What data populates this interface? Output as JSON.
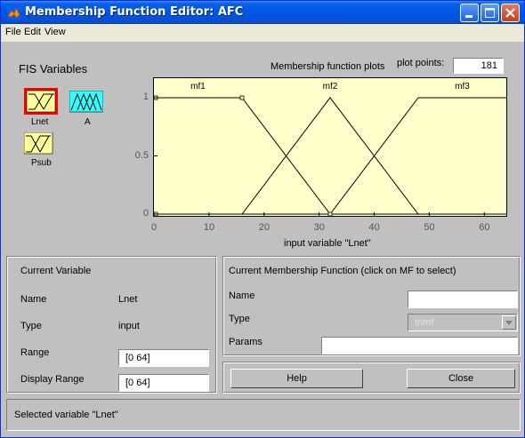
{
  "window": {
    "title": "Membership Function Editor: AFC"
  },
  "menu": [
    "File",
    "Edit",
    "View"
  ],
  "fis": {
    "title": "FIS Variables",
    "vars": [
      {
        "label": "Lnet",
        "kind": "input",
        "selected": true
      },
      {
        "label": "A",
        "kind": "output",
        "selected": false
      },
      {
        "label": "Psub",
        "kind": "input",
        "selected": false
      }
    ]
  },
  "plot": {
    "header": "Membership function plots",
    "points_label": "plot points:",
    "points_value": "181",
    "xlabel": "input variable \"Lnet\"",
    "x_ticks": [
      "0",
      "10",
      "20",
      "30",
      "40",
      "50",
      "60"
    ],
    "y_ticks": [
      "0",
      "0.5",
      "1"
    ],
    "mf_labels": [
      "mf1",
      "mf2",
      "mf3"
    ],
    "background": "#ffffcc"
  },
  "chart_data": {
    "type": "line",
    "title": "Membership function plots",
    "xlabel": "input variable \"Lnet\"",
    "ylabel": "",
    "xlim": [
      0,
      64
    ],
    "ylim": [
      0,
      1
    ],
    "series": [
      {
        "name": "mf1",
        "x": [
          0,
          16,
          32,
          64
        ],
        "y": [
          1,
          1,
          0,
          0
        ]
      },
      {
        "name": "mf2",
        "x": [
          0,
          16,
          32,
          48,
          64
        ],
        "y": [
          0,
          0,
          1,
          0,
          0
        ]
      },
      {
        "name": "mf3",
        "x": [
          0,
          32,
          48,
          64
        ],
        "y": [
          0,
          0,
          1,
          1
        ]
      }
    ]
  },
  "current_variable": {
    "heading": "Current Variable",
    "name_label": "Name",
    "name_value": "Lnet",
    "type_label": "Type",
    "type_value": "input",
    "range_label": "Range",
    "range_value": "[0 64]",
    "display_range_label": "Display Range",
    "display_range_value": "[0 64]"
  },
  "current_mf": {
    "heading": "Current Membership Function (click on MF to select)",
    "name_label": "Name",
    "name_value": "",
    "type_label": "Type",
    "type_value": "trimf",
    "params_label": "Params",
    "params_value": ""
  },
  "buttons": {
    "help": "Help",
    "close": "Close"
  },
  "status": "Selected variable \"Lnet\""
}
